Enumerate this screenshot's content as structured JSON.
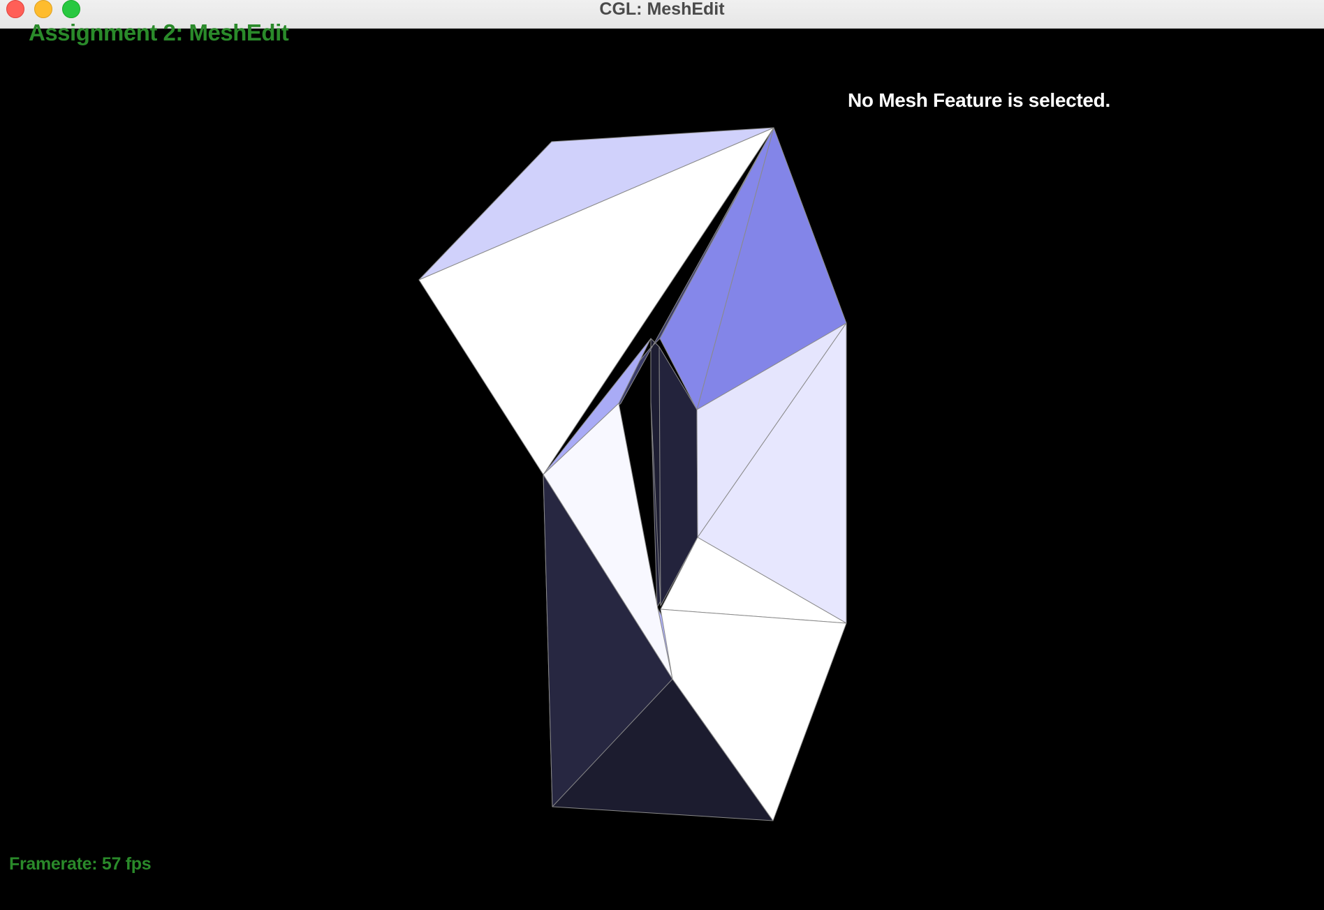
{
  "window": {
    "title": "CGL: MeshEdit"
  },
  "overlay": {
    "assignment_title": "Assignment 2: MeshEdit",
    "selection_status": "No Mesh Feature is selected.",
    "framerate": "Framerate: 57 fps"
  },
  "colors": {
    "background": "#000000",
    "hud_green": "#2a8a2a",
    "status_text": "#ffffff",
    "titlebar": "#ececec",
    "traffic_close": "#ff5f57",
    "traffic_minimize": "#febc2e",
    "traffic_zoom": "#28c840",
    "mesh_edge": "#888888"
  },
  "icons": {
    "close": "close-dot",
    "minimize": "minimize-dot",
    "zoom": "zoom-dot"
  }
}
